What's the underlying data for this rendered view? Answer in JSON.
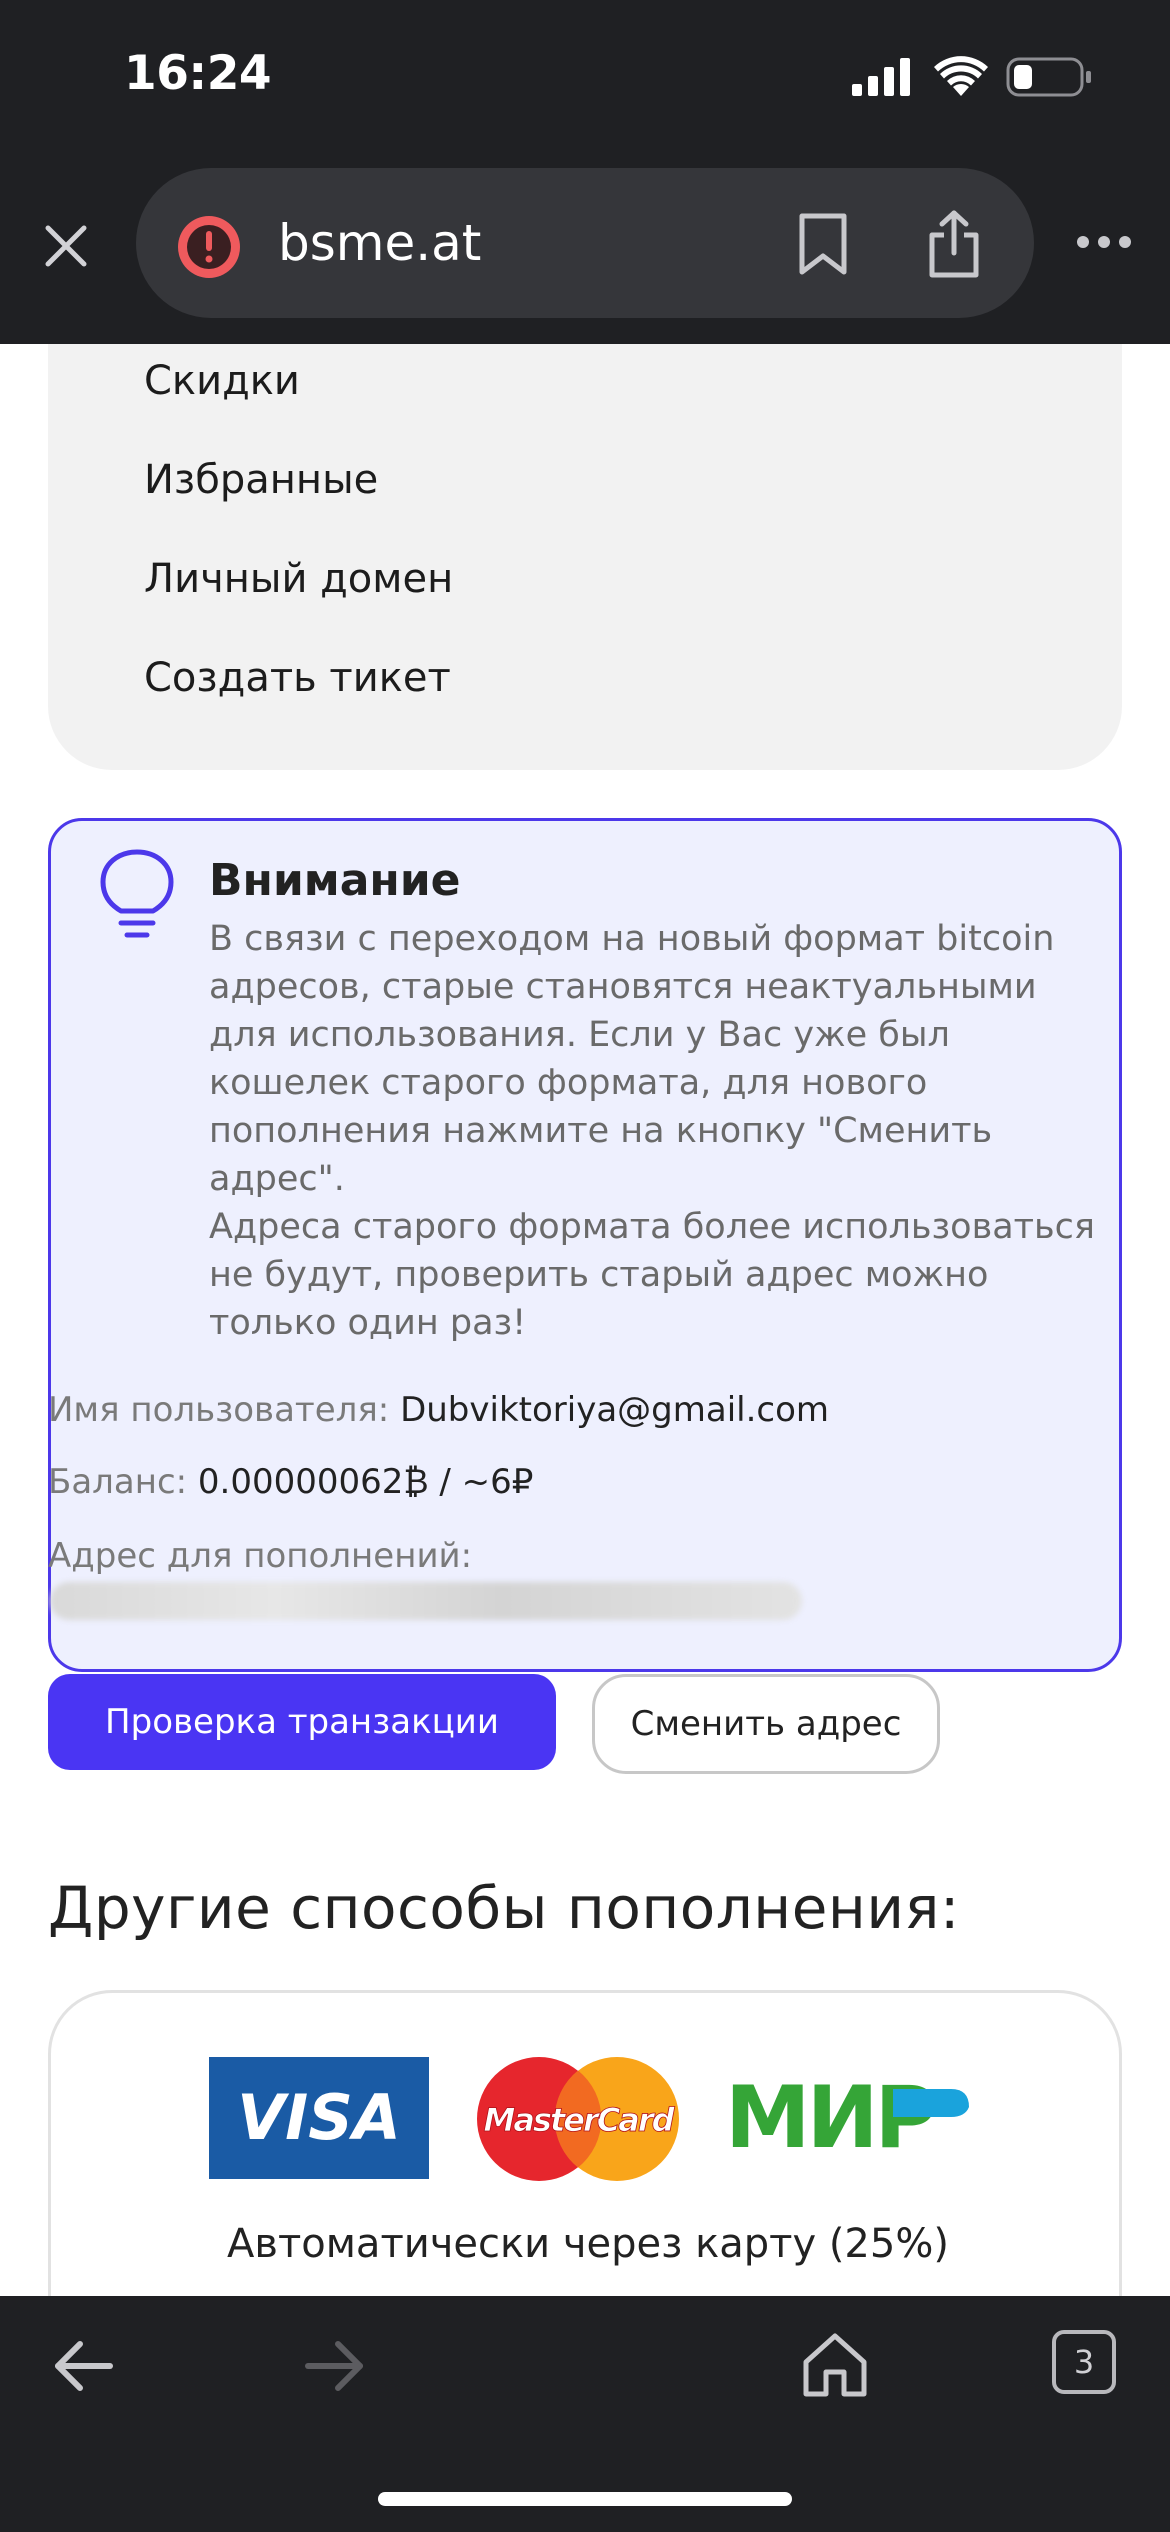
{
  "status_bar": {
    "time": "16:24"
  },
  "browser": {
    "url": "bsme.at",
    "tab_count": "3"
  },
  "menu": {
    "items": [
      {
        "label": "Скидки"
      },
      {
        "label": "Избранные"
      },
      {
        "label": "Личный домен"
      },
      {
        "label": "Создать тикет"
      }
    ]
  },
  "notice": {
    "title": "Внимание",
    "text": "В связи с переходом на новый формат bitcoin адресов, старые становятся неактуальными для использования. Если у Вас уже был кошелек старого формата, для нового пополнения нажмите на кнопку \"Сменить адрес\".\nАдреса старого формата более использоваться не будут, проверить старый адрес можно только один раз!",
    "accent_color": "#4c38ea",
    "background_color": "#eef0fe"
  },
  "account": {
    "username_label": "Имя пользователя:",
    "username_value": "Dubviktoriya@gmail.com",
    "balance_label": "Баланс:",
    "balance_value": "0.00000062₿ / ~6₽",
    "address_label": "Адрес для пополнений:"
  },
  "buttons": {
    "check_transaction": "Проверка транзакции",
    "change_address": "Сменить адрес",
    "primary_color": "#4a35f3"
  },
  "other_methods": {
    "title": "Другие способы пополнения:",
    "logos": {
      "visa": "VISA",
      "mastercard": "MasterCard",
      "mir": "МИР"
    },
    "card_caption": "Автоматически через карту (25%)"
  }
}
